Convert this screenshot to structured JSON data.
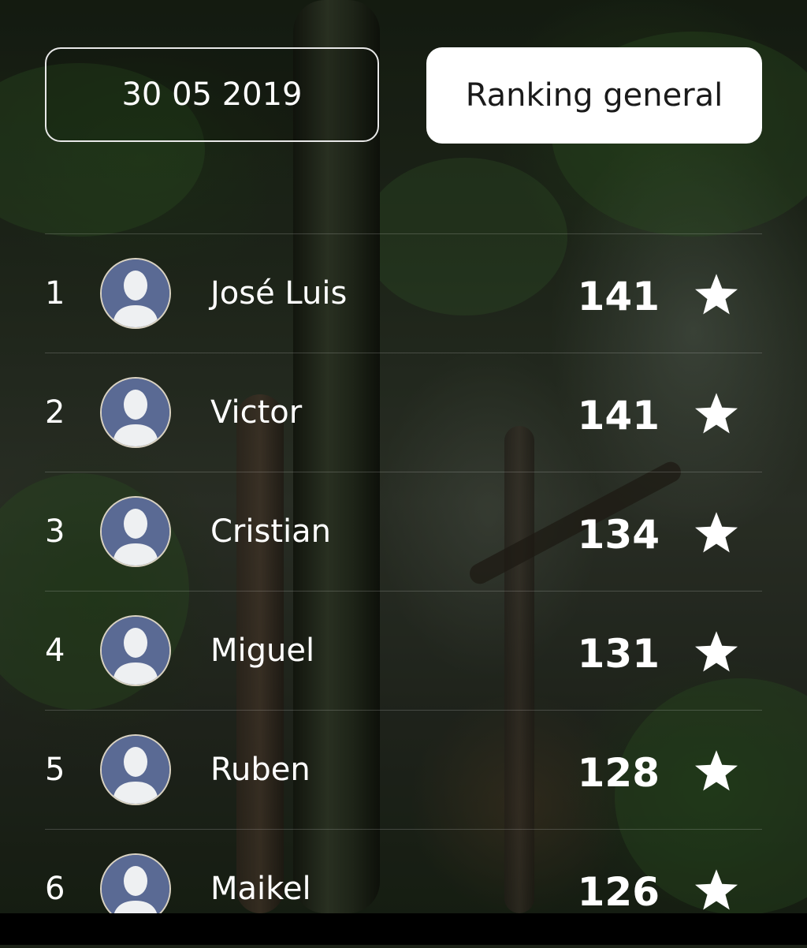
{
  "header": {
    "date_label": "30 05 2019",
    "ranking_label": "Ranking general"
  },
  "ranking": [
    {
      "position": "1",
      "name": "José Luis",
      "points": "141",
      "icon": "star-icon"
    },
    {
      "position": "2",
      "name": "Victor",
      "points": "141",
      "icon": "star-icon"
    },
    {
      "position": "3",
      "name": "Cristian",
      "points": "134",
      "icon": "star-icon"
    },
    {
      "position": "4",
      "name": "Miguel",
      "points": "131",
      "icon": "star-icon"
    },
    {
      "position": "5",
      "name": "Ruben",
      "points": "128",
      "icon": "star-icon"
    },
    {
      "position": "6",
      "name": "Maikel",
      "points": "126",
      "icon": "star-icon"
    }
  ],
  "colors": {
    "avatar_bg": "#5a6a94",
    "ranking_button_bg": "#ffffff",
    "text": "#ffffff"
  }
}
